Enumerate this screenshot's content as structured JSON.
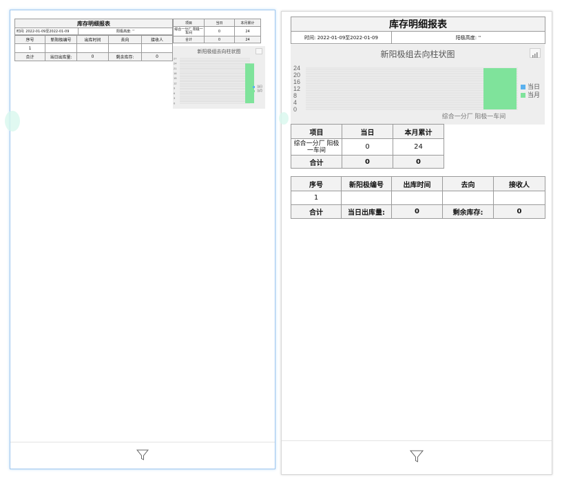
{
  "report": {
    "title": "库存明细报表",
    "time_label": "时间: 2022-01-09至2022-01-09",
    "time_label_right": "时间: 2022-01-09至2022-01-09",
    "cathode_height_label": "阳极高度: ''",
    "cathode_height_label_left": "阳极高度: ''"
  },
  "detail_table": {
    "headers": [
      "序号",
      "新阳极编号",
      "出库时间",
      "去向",
      "接收人"
    ],
    "rows": [
      [
        "1",
        "",
        "",
        "",
        ""
      ]
    ],
    "total_label": "合计",
    "today_out_label": "当日出库量:",
    "today_out_value": "0",
    "remaining_label": "剩余库存:",
    "remaining_value": "0"
  },
  "summary_table": {
    "headers": [
      "项目",
      "当日",
      "本月累计"
    ],
    "rows": [
      [
        "综合一分厂 阳极一车间",
        "0",
        "24"
      ]
    ],
    "total_row": [
      "合计",
      "0",
      "0"
    ],
    "total_row_left": [
      "合计",
      "0",
      "24"
    ]
  },
  "chart_data": {
    "type": "bar",
    "title": "新阳极组去向柱状图",
    "categories": [
      "综合一分厂 阳极一车间"
    ],
    "series": [
      {
        "name": "当日",
        "values": [
          0
        ],
        "color": "#5ab1ef"
      },
      {
        "name": "当月",
        "values": [
          24
        ],
        "color": "#7fe39b"
      }
    ],
    "ylim": [
      0,
      24
    ],
    "yticks_right": [
      0,
      4,
      8,
      12,
      16,
      20,
      24
    ],
    "yticks_left": [
      0,
      3,
      6,
      9,
      12,
      15,
      18,
      21,
      24,
      27
    ],
    "grid": true,
    "legend_position": "right",
    "toolbox_icon": "bar-chart-icon"
  },
  "footer": {
    "icon": "filter-icon"
  }
}
